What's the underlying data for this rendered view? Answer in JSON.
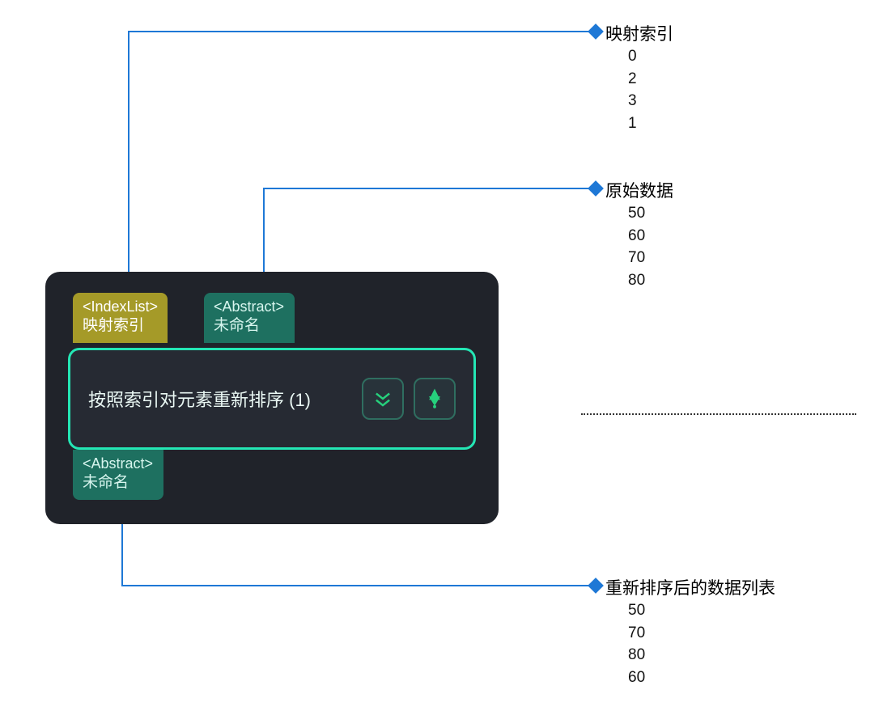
{
  "node": {
    "tab_index": {
      "type": "<IndexList>",
      "label": "映射索引"
    },
    "tab_abstract_in": {
      "type": "<Abstract>",
      "label": "未命名"
    },
    "tab_abstract_out": {
      "type": "<Abstract>",
      "label": "未命名"
    },
    "main_title": "按照索引对元素重新排序 (1)"
  },
  "callouts": {
    "index": {
      "heading": "映射索引",
      "values": [
        "0",
        "2",
        "3",
        "1"
      ]
    },
    "source": {
      "heading": "原始数据",
      "values": [
        "50",
        "60",
        "70",
        "80"
      ]
    },
    "result": {
      "heading": "重新排序后的数据列表",
      "values": [
        "50",
        "70",
        "80",
        "60"
      ]
    }
  },
  "colors": {
    "connector": "#1e78d6",
    "accent": "#24e6b4",
    "tab_index_bg": "#a59a28",
    "tab_abstract_bg": "#1e7060",
    "panel_bg": "#20232a"
  }
}
